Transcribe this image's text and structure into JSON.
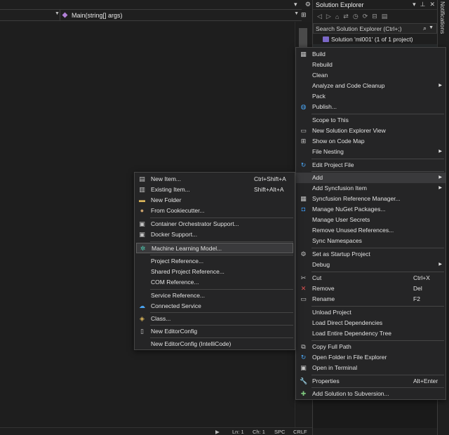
{
  "editor": {
    "method_label": "Main(string[] args)",
    "split_icon": "⊞"
  },
  "status_bar": {
    "line": "Ln: 1",
    "char": "Ch: 1",
    "spacing": "SPC",
    "line_ending": "CRLF"
  },
  "solution_explorer": {
    "title": "Solution Explorer",
    "search_placeholder": "Search Solution Explorer (Ctrl+;)",
    "solution_label": "Solution 'ml001' (1 of 1 project)"
  },
  "notifications": {
    "label": "Notifications"
  },
  "main_menu": {
    "items": [
      {
        "label": "Build",
        "icon": "build-icon"
      },
      {
        "label": "Rebuild",
        "icon": ""
      },
      {
        "label": "Clean",
        "icon": ""
      },
      {
        "label": "Analyze and Code Cleanup",
        "icon": "",
        "submenu": true
      },
      {
        "label": "Pack",
        "icon": ""
      },
      {
        "label": "Publish...",
        "icon": "globe-icon"
      },
      {
        "label": "Scope to This",
        "icon": ""
      },
      {
        "label": "New Solution Explorer View",
        "icon": "new-view-icon"
      },
      {
        "label": "Show on Code Map",
        "icon": "code-map-icon"
      },
      {
        "label": "File Nesting",
        "icon": "",
        "submenu": true
      },
      {
        "label": "Edit Project File",
        "icon": "refresh-icon"
      },
      {
        "label": "Add",
        "icon": "",
        "submenu": true,
        "active": true
      },
      {
        "label": "Add Syncfusion Item",
        "icon": "",
        "submenu": true
      },
      {
        "label": "Syncfusion Reference Manager...",
        "icon": "grid-icon"
      },
      {
        "label": "Manage NuGet Packages...",
        "icon": "nuget-icon"
      },
      {
        "label": "Manage User Secrets",
        "icon": ""
      },
      {
        "label": "Remove Unused References...",
        "icon": ""
      },
      {
        "label": "Sync Namespaces",
        "icon": ""
      },
      {
        "label": "Set as Startup Project",
        "icon": "gear-icon"
      },
      {
        "label": "Debug",
        "icon": "",
        "submenu": true
      },
      {
        "label": "Cut",
        "icon": "scissors-icon",
        "shortcut": "Ctrl+X"
      },
      {
        "label": "Remove",
        "icon": "remove-icon",
        "shortcut": "Del"
      },
      {
        "label": "Rename",
        "icon": "rename-icon",
        "shortcut": "F2"
      },
      {
        "label": "Unload Project",
        "icon": ""
      },
      {
        "label": "Load Direct Dependencies",
        "icon": ""
      },
      {
        "label": "Load Entire Dependency Tree",
        "icon": ""
      },
      {
        "label": "Copy Full Path",
        "icon": "copy-icon"
      },
      {
        "label": "Open Folder in File Explorer",
        "icon": "open-folder-icon"
      },
      {
        "label": "Open in Terminal",
        "icon": "terminal-icon"
      },
      {
        "label": "Properties",
        "icon": "wrench-icon",
        "shortcut": "Alt+Enter"
      },
      {
        "label": "Add Solution to Subversion...",
        "icon": "svn-icon"
      }
    ]
  },
  "sub_menu": {
    "items": [
      {
        "label": "New Item...",
        "icon": "new-item-icon",
        "shortcut": "Ctrl+Shift+A"
      },
      {
        "label": "Existing Item...",
        "icon": "existing-item-icon",
        "shortcut": "Shift+Alt+A"
      },
      {
        "label": "New Folder",
        "icon": "folder-icon"
      },
      {
        "label": "From Cookiecutter...",
        "icon": "cookiecutter-icon"
      },
      {
        "label": "Container Orchestrator Support...",
        "icon": "container-icon"
      },
      {
        "label": "Docker Support...",
        "icon": "docker-icon"
      },
      {
        "label": "Machine Learning Model...",
        "icon": "ml-model-icon",
        "active": true
      },
      {
        "label": "Project Reference...",
        "icon": ""
      },
      {
        "label": "Shared Project Reference...",
        "icon": ""
      },
      {
        "label": "COM Reference...",
        "icon": ""
      },
      {
        "label": "Service Reference...",
        "icon": ""
      },
      {
        "label": "Connected Service",
        "icon": "connected-service-icon"
      },
      {
        "label": "Class...",
        "icon": "class-icon"
      },
      {
        "label": "New EditorConfig",
        "icon": "editorconfig-icon"
      },
      {
        "label": "New EditorConfig (IntelliCode)",
        "icon": ""
      }
    ]
  }
}
